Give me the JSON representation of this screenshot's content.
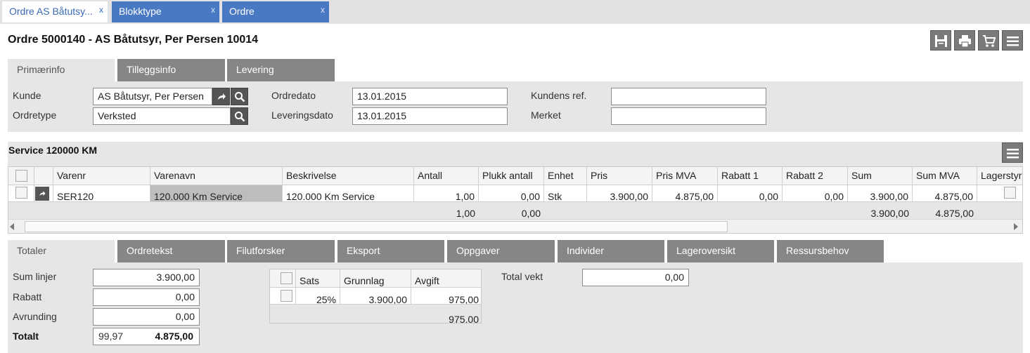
{
  "window_tabs": [
    {
      "label": "Ordre AS Båtutsy...",
      "close": "x"
    },
    {
      "label": "Blokktype",
      "close": "x"
    },
    {
      "label": "Ordre",
      "close": "x"
    }
  ],
  "title": "Ordre 5000140 - AS Båtutsyr, Per Persen 10014",
  "toolbar_icons": [
    "save-icon",
    "print-icon",
    "cart-icon",
    "menu-icon"
  ],
  "main_tabs": [
    "Primærinfo",
    "Tilleggsinfo",
    "Levering"
  ],
  "form": {
    "kunde_label": "Kunde",
    "kunde_value": "AS Båtutsyr, Per  Persen",
    "ordretype_label": "Ordretype",
    "ordretype_value": "Verksted",
    "ordredato_label": "Ordredato",
    "ordredato_value": "13.01.2015",
    "leveringsdato_label": "Leveringsdato",
    "leveringsdato_value": "13.01.2015",
    "kundens_ref_label": "Kundens ref.",
    "kundens_ref_value": "",
    "merket_label": "Merket",
    "merket_value": ""
  },
  "block_title": "Service 120000 KM",
  "lines_grid": {
    "headers": [
      "Varenr",
      "Varenavn",
      "Beskrivelse",
      "Antall",
      "Plukk antall",
      "Enhet",
      "Pris",
      "Pris MVA",
      "Rabatt 1",
      "Rabatt 2",
      "Sum",
      "Sum MVA",
      "Lagerstyr"
    ],
    "row": {
      "varenr": "SER120",
      "varenavn": "120.000 Km Service",
      "beskrivelse": "120.000 Km Service",
      "antall": "1,00",
      "plukk_antall": "0,00",
      "enhet": "Stk",
      "pris": "3.900,00",
      "pris_mva": "4.875,00",
      "rabatt1": "0,00",
      "rabatt2": "0,00",
      "sum": "3.900,00",
      "sum_mva": "4.875,00"
    },
    "totals": {
      "antall": "1,00",
      "plukk_antall": "0,00",
      "sum": "3.900,00",
      "sum_mva": "4.875,00"
    }
  },
  "bottom_tabs": [
    "Totaler",
    "Ordretekst",
    "Filutforsker",
    "Eksport",
    "Oppgaver",
    "Individer",
    "Lageroversikt",
    "Ressursbehov"
  ],
  "totals": {
    "sum_linjer_label": "Sum linjer",
    "sum_linjer_value": "3.900,00",
    "rabatt_label": "Rabatt",
    "rabatt_value": "0,00",
    "avrunding_label": "Avrunding",
    "avrunding_value": "0,00",
    "totalt_label": "Totalt",
    "totalt_left": "99,97",
    "totalt_value": "4.875,00",
    "total_vekt_label": "Total vekt",
    "total_vekt_value": "0,00"
  },
  "vat_grid": {
    "headers": [
      "Sats",
      "Grunnlag",
      "Avgift"
    ],
    "row": {
      "sats": "25%",
      "grunnlag": "3.900,00",
      "avgift": "975,00"
    },
    "total_avgift": "975,00"
  }
}
